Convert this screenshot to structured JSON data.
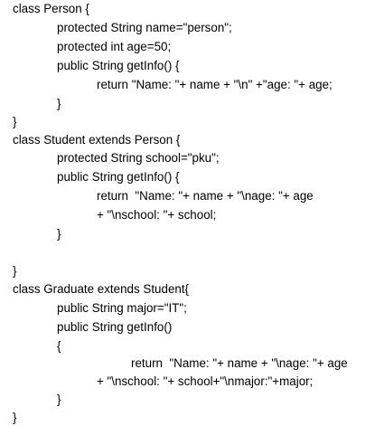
{
  "code_lines": [
    "class Person {",
    "protected String name=\"person\";",
    "protected int age=50;",
    "public String getInfo() {",
    "return \"Name: \"+ name + \"\\n\" +\"age: \"+ age;",
    "}",
    "}",
    "class Student extends Person {",
    "protected String school=\"pku\";",
    "public String getInfo() {",
    "return  \"Name: \"+ name + \"\\nage: \"+ age",
    "+ \"\\nschool: \"+ school;",
    "}",
    "",
    "}",
    "class Graduate extends Student{",
    "public String major=\"IT\";",
    "public String getInfo()",
    "{",
    "return  \"Name: \"+ name + \"\\nage: \"+ age",
    "+ \"\\nschool: \"+ school+\"\\nmajor:\"+major;",
    "}",
    "}"
  ]
}
